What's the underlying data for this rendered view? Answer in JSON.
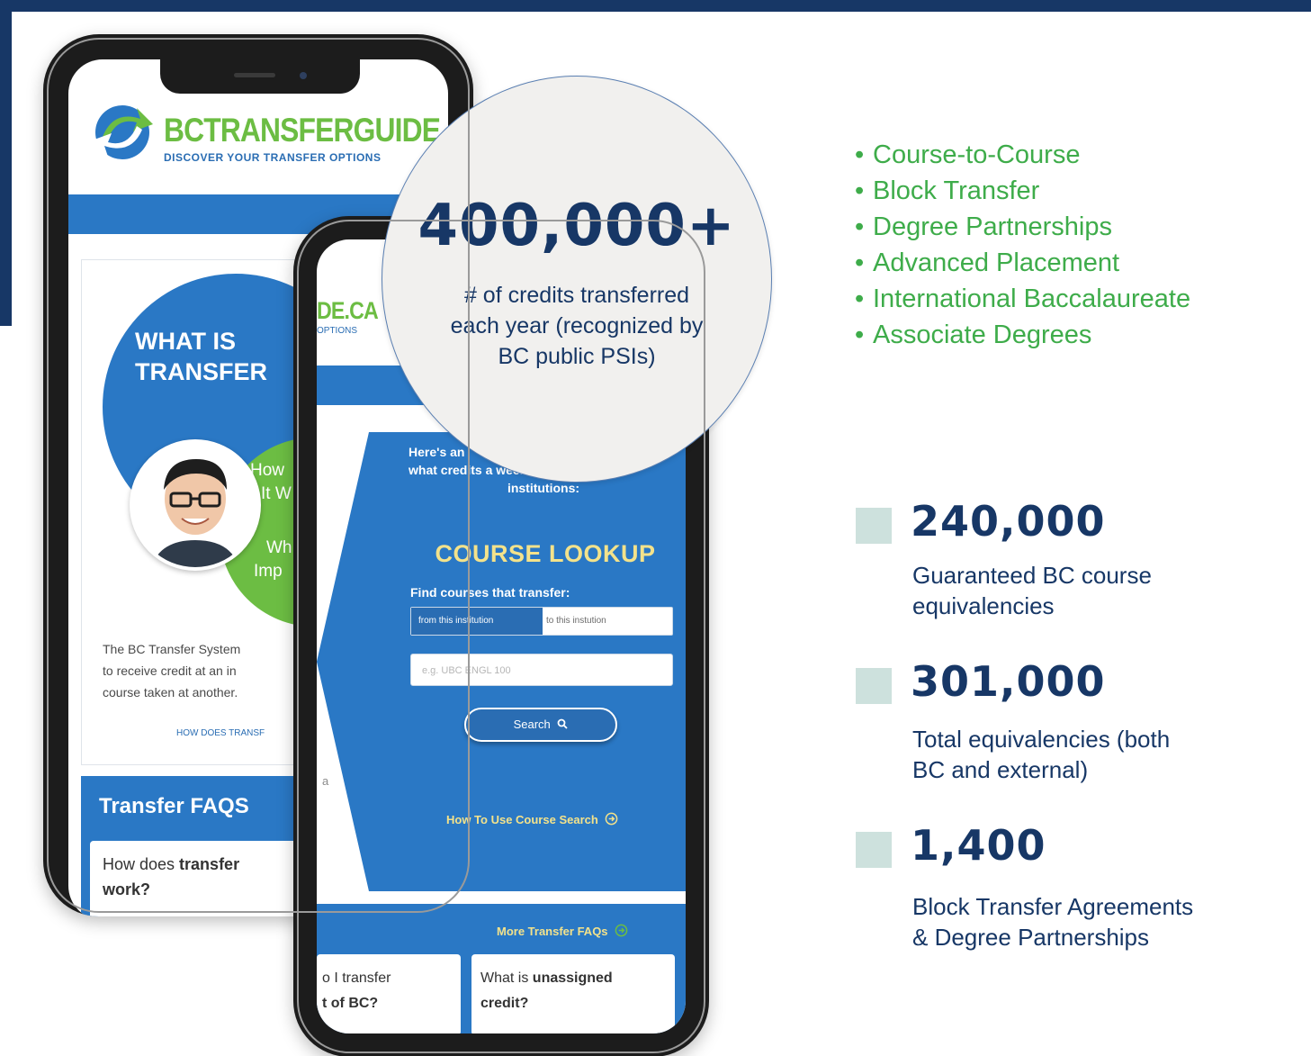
{
  "highlight": {
    "value": "400,000+",
    "caption_lines": [
      "# of credits transferred",
      "each year (recognized by",
      "BC public PSIs)"
    ]
  },
  "transfer_types": [
    "Course-to-Course",
    "Block Transfer",
    "Degree Partnerships",
    "Advanced Placement",
    "International Baccalaureate",
    "Associate Degrees"
  ],
  "bullet_glyph": "•",
  "stats": [
    {
      "value": "240,000",
      "desc_lines": [
        "Guaranteed BC course",
        "equivalencies"
      ]
    },
    {
      "value": "301,000",
      "desc_lines": [
        "Total equivalencies (both",
        "BC and external)"
      ]
    },
    {
      "value": "1,400",
      "desc_lines": [
        "Block Transfer Agreements",
        "& Degree Partnerships"
      ]
    }
  ],
  "back_phone": {
    "logo_text": "BCTRANSFERGUIDE.CA",
    "logo_tagline": "DISCOVER YOUR TRANSFER OPTIONS",
    "hero_title_lines": [
      "WHAT IS",
      "TRANSFER"
    ],
    "green_lines": [
      "How",
      "It W",
      "Wh",
      "Imp"
    ],
    "intro_lines": [
      "The BC Transfer System",
      "to receive credit at an in",
      "course taken at another."
    ],
    "how_link": "HOW DOES TRANSF",
    "faq_title": "Transfer FAQS",
    "faq_question_lines": [
      "How does transfer",
      "work?"
    ],
    "faq_bold_word": "transfer"
  },
  "front_phone": {
    "logo_text": "DE.CA",
    "logo_tagline": "OPTIONS",
    "intro_lines": [
      "Here's an",
      "what credits a            ween",
      "institutions:"
    ],
    "lookup_title": "COURSE LOOKUP",
    "find_label": "Find courses that transfer:",
    "toggle_from": "from this institution",
    "toggle_to": "to this instution",
    "input_placeholder": "e.g. UBC ENGL 100",
    "search_label": "Search",
    "howto_link": "How To Use Course Search",
    "more_faqs": "More Transfer FAQs",
    "card1_lines": [
      "o I transfer",
      "t of BC?"
    ],
    "card2_prefix": "What is",
    "card2_bold": "unassigned",
    "card2_line2": "credit?",
    "faded_letters": [
      "a"
    ]
  },
  "colors": {
    "navy": "#173766",
    "green": "#3eac4a",
    "stat_square": "#cde1dd",
    "site_blue": "#2a78c5",
    "site_green": "#6cbd43",
    "accent_yellow": "#f3e28b"
  }
}
